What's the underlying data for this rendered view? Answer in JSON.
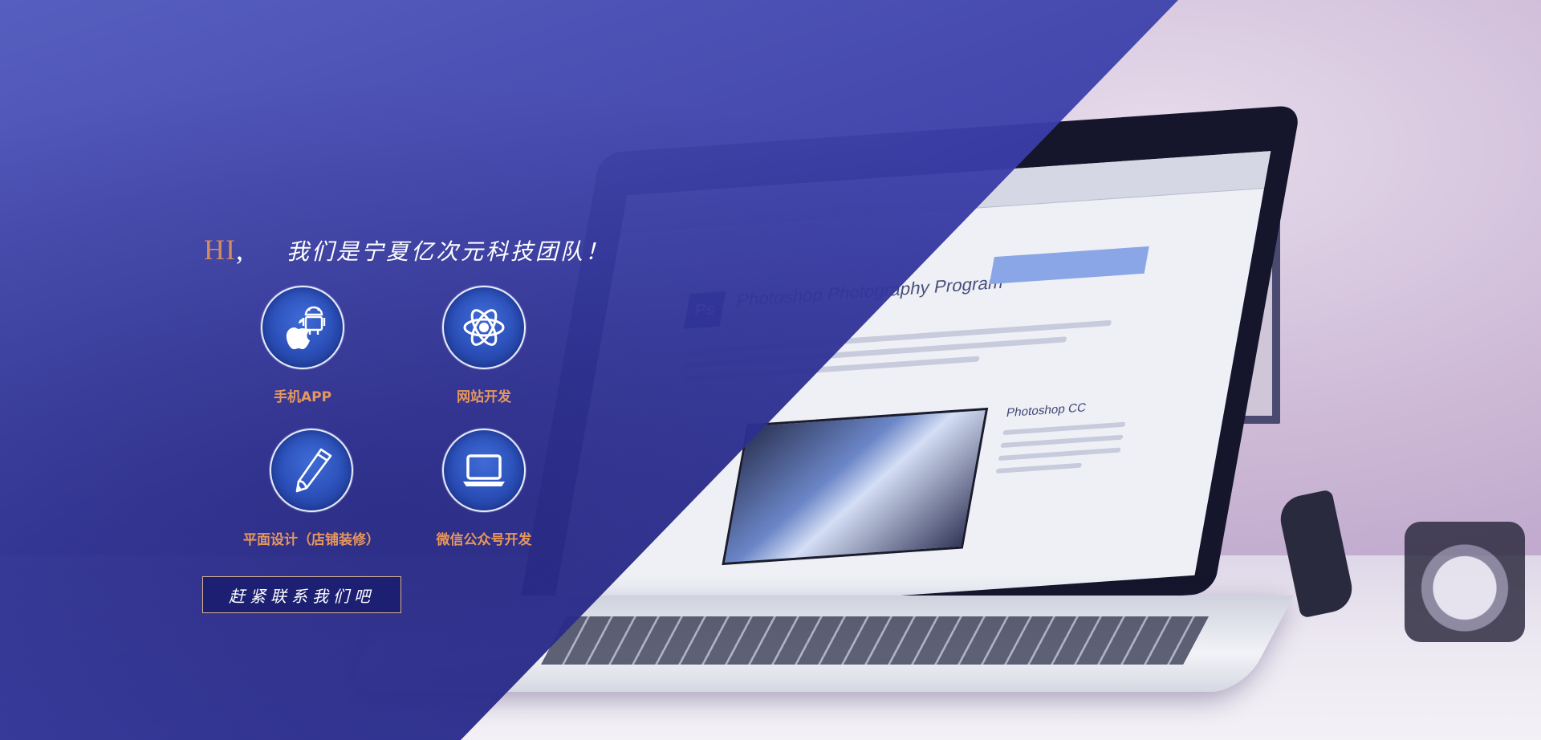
{
  "hero": {
    "greeting": "HI",
    "greeting_punct": ",",
    "slogan": "我们是宁夏亿次元科技团队！",
    "accent_color": "#d48b60",
    "overlay_color": "#3a3da8"
  },
  "services": [
    {
      "label": "手机APP",
      "icon": "mobile-app-icon"
    },
    {
      "label": "网站开发",
      "icon": "atom-icon"
    },
    {
      "label": "平面设计（店铺装修）",
      "icon": "pen-icon"
    },
    {
      "label": "微信公众号开发",
      "icon": "laptop-icon"
    }
  ],
  "cta": {
    "label": "赶紧联系我们吧"
  },
  "label_color": "#e6975d"
}
